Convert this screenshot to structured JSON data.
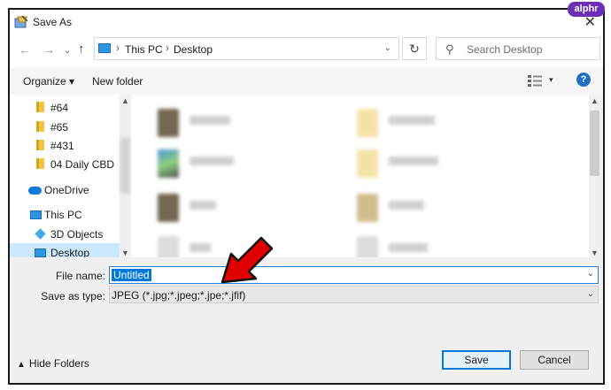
{
  "watermark": "alphr",
  "window": {
    "title": "Save As",
    "close_glyph": "✕"
  },
  "navigation": {
    "back_glyph": "←",
    "forward_glyph": "→",
    "recent_glyph": "⌄",
    "up_glyph": "↑",
    "breadcrumb": [
      "This PC",
      "Desktop"
    ],
    "refresh_glyph": "↻",
    "search_placeholder": "Search Desktop"
  },
  "toolbar": {
    "organize_label": "Organize ▾",
    "new_folder_label": "New folder",
    "view_drop_glyph": "▾",
    "help_glyph": "?"
  },
  "sidebar": {
    "items": [
      {
        "label": "#64",
        "icon": "folder-icon"
      },
      {
        "label": "#65",
        "icon": "folder-icon"
      },
      {
        "label": "#431",
        "icon": "folder-icon"
      },
      {
        "label": "04 Daily CBD",
        "icon": "folder-icon"
      },
      {
        "label": "OneDrive",
        "icon": "onedrive-icon"
      },
      {
        "label": "This PC",
        "icon": "computer-icon"
      },
      {
        "label": "3D Objects",
        "icon": "3d-objects-icon"
      },
      {
        "label": "Desktop",
        "icon": "desktop-icon",
        "selected": true
      }
    ]
  },
  "form": {
    "file_name_label": "File name:",
    "file_name_value": "Untitled",
    "save_as_type_label": "Save as type:",
    "save_as_type_value": "JPEG (*.jpg;*.jpeg;*.jpe;*.jfif)"
  },
  "footer": {
    "hide_folders_label": "Hide Folders",
    "save_label": "Save",
    "cancel_label": "Cancel"
  },
  "colors": {
    "accent": "#0078d7",
    "selection": "#cce8ff",
    "annotation_arrow": "#e00000",
    "watermark_bg": "#6a2fb5"
  }
}
